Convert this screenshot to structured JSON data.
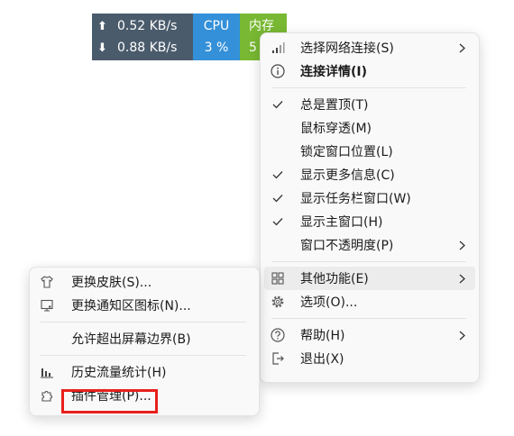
{
  "widget": {
    "upload_arrow": "⬆",
    "upload_speed": "0.52 KB/s",
    "download_arrow": "⬇",
    "download_speed": "0.88 KB/s",
    "cpu_label": "CPU",
    "cpu_value": "3 %",
    "mem_label": "内存",
    "mem_value": "5",
    "colors": {
      "net_bg": "#4a5b6c",
      "cpu_bg": "#3490d8",
      "mem_bg": "#78b832"
    }
  },
  "main_menu": {
    "items": [
      {
        "label": "选择网络连接(S)",
        "icon": "signal-bars-icon",
        "submenu": true
      },
      {
        "label": "连接详情(I)",
        "icon": "info-icon",
        "bold": true
      },
      {
        "label": "总是置顶(T)",
        "checked": true
      },
      {
        "label": "鼠标穿透(M)",
        "checked": false
      },
      {
        "label": "锁定窗口位置(L)",
        "checked": false
      },
      {
        "label": "显示更多信息(C)",
        "checked": true
      },
      {
        "label": "显示任务栏窗口(W)",
        "checked": true
      },
      {
        "label": "显示主窗口(H)",
        "checked": true
      },
      {
        "label": "窗口不透明度(P)",
        "submenu": true
      },
      {
        "label": "其他功能(E)",
        "icon": "grid-icon",
        "submenu": true,
        "highlighted": true
      },
      {
        "label": "选项(O)...",
        "icon": "gear-icon"
      },
      {
        "label": "帮助(H)",
        "icon": "help-icon",
        "submenu": true
      },
      {
        "label": "退出(X)",
        "icon": "exit-icon"
      }
    ]
  },
  "sub_menu": {
    "items": [
      {
        "label": "更换皮肤(S)...",
        "icon": "shirt-icon"
      },
      {
        "label": "更换通知区图标(N)...",
        "icon": "monitor-icon"
      },
      {
        "label": "允许超出屏幕边界(B)"
      },
      {
        "label": "历史流量统计(H)",
        "icon": "bar-chart-icon"
      },
      {
        "label": "插件管理(P)...",
        "icon": "puzzle-icon"
      }
    ]
  },
  "annotation": {
    "highlight_color": "#e8201b"
  }
}
